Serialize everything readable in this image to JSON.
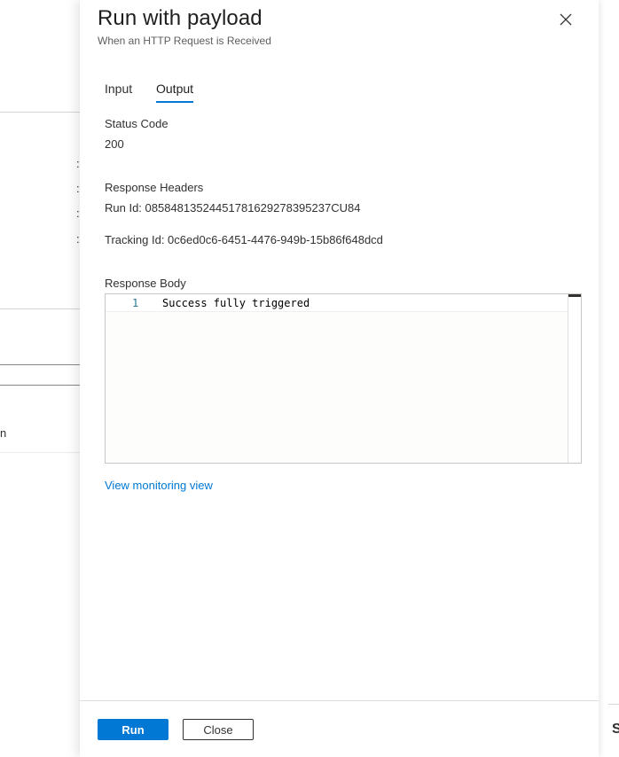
{
  "panel": {
    "title": "Run with payload",
    "subtitle": "When an HTTP Request is Received",
    "close_icon": "close-icon"
  },
  "tabs": [
    {
      "label": "Input",
      "active": false
    },
    {
      "label": "Output",
      "active": true
    }
  ],
  "output": {
    "status_code_label": "Status Code",
    "status_code_value": "200",
    "response_headers_label": "Response Headers",
    "run_id": "Run Id: 08584813524451781629278395237CU84",
    "tracking_id": "Tracking Id: 0c6ed0c6-6451-4476-949b-15b86f648dcd",
    "response_body_label": "Response Body",
    "response_body_lines": [
      {
        "number": "1",
        "text": "Success fully triggered"
      }
    ]
  },
  "links": {
    "monitoring": "View monitoring view"
  },
  "footer": {
    "run_label": "Run",
    "close_label": "Close"
  },
  "background": {
    "partial_letter": "n",
    "partial_right_char": "S"
  },
  "colors": {
    "accent": "#0078d4",
    "text": "#323130",
    "subtle": "#605e5c"
  }
}
